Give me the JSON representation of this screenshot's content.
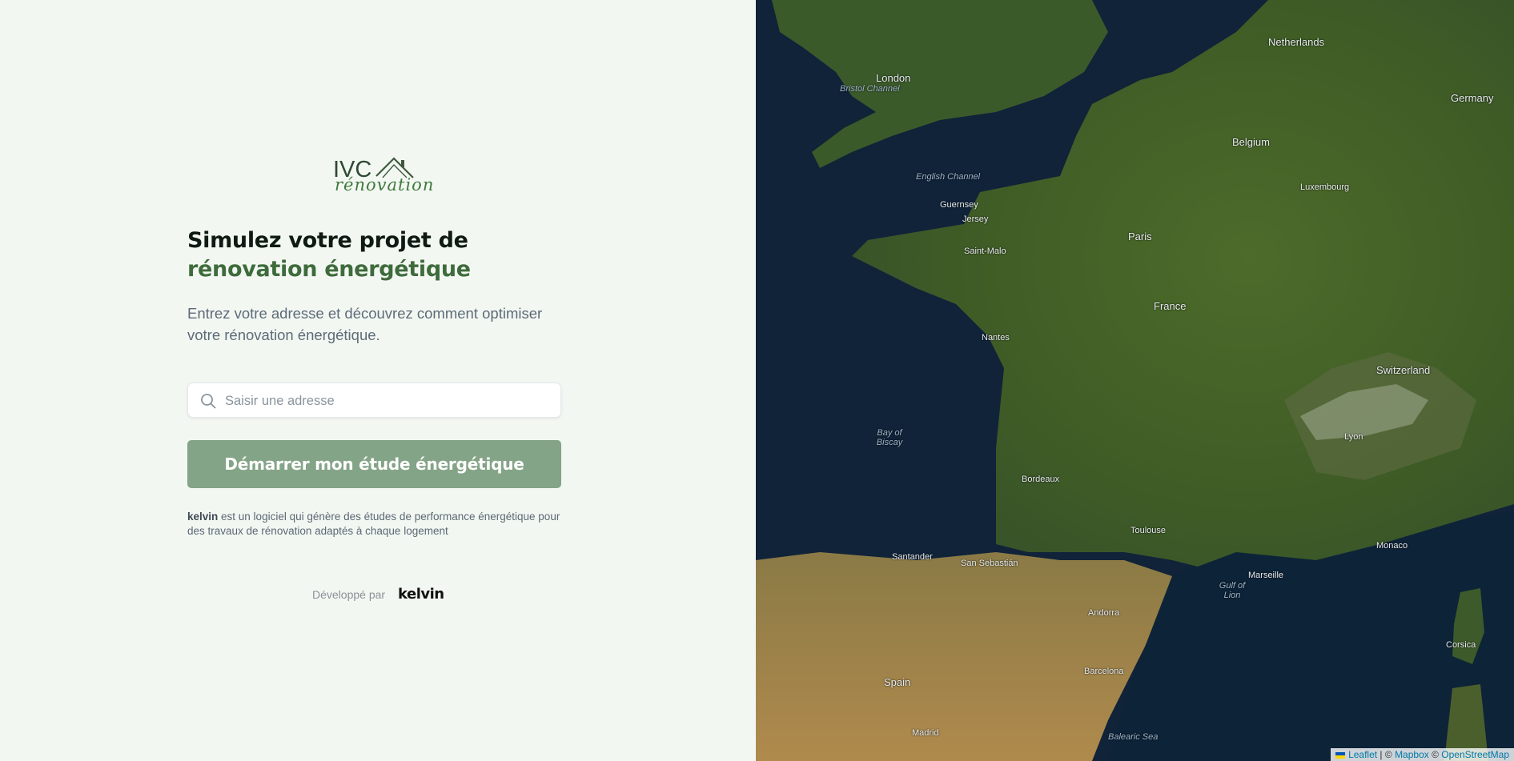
{
  "brand": {
    "logo_top": "IVC",
    "logo_bottom": "rénovation",
    "accent_color": "#3e6b3b",
    "button_color": "#84a487"
  },
  "hero": {
    "title_line1": "Simulez votre projet de",
    "title_line2": "rénovation énergétique",
    "intro": "Entrez votre adresse et découvrez comment optimiser votre rénovation énergétique."
  },
  "search": {
    "placeholder": "Saisir une adresse",
    "value": "",
    "icon": "search-icon"
  },
  "cta": {
    "label": "Démarrer mon étude énergétique"
  },
  "description": {
    "bold": "kelvin",
    "text": " est un logiciel qui génère des études de performance énergétique pour des travaux de rénovation adaptés à chaque logement"
  },
  "credit": {
    "prefix": "Développé par",
    "brand": "kelvin"
  },
  "map": {
    "labels": [
      "London",
      "Bristol Channel",
      "English Channel",
      "Guernsey",
      "Jersey",
      "Saint-Malo",
      "Paris",
      "France",
      "Belgium",
      "Netherlands",
      "Luxembourg",
      "Germany",
      "Switzerland",
      "Bay of Biscay",
      "Santander",
      "San Sebastián",
      "Spain",
      "Madrid",
      "Barcelona",
      "Andorra",
      "Marseille",
      "Gulf of Lion",
      "Monaco",
      "Corsica",
      "Balearic Sea",
      "Lyon",
      "Bordeaux",
      "Toulouse",
      "Nantes"
    ],
    "attribution": {
      "leaflet": "Leaflet",
      "mapbox": "Mapbox",
      "osm": "OpenStreetMap"
    }
  }
}
